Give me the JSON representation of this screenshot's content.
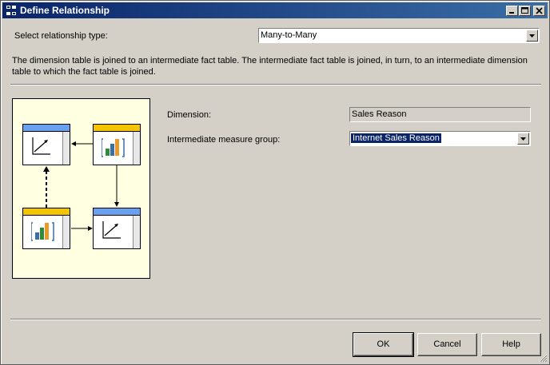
{
  "window": {
    "title": "Define Relationship"
  },
  "relationship_type": {
    "label": "Select relationship type:",
    "value": "Many-to-Many"
  },
  "description": "The dimension table is joined to an intermediate fact table. The intermediate fact table is joined, in turn, to an intermediate dimension table to which the fact table is joined.",
  "dimension": {
    "label": "Dimension:",
    "value": "Sales Reason"
  },
  "intermediate_measure_group": {
    "label": "Intermediate measure group:",
    "value": "Internet Sales Reason"
  },
  "buttons": {
    "ok": "OK",
    "cancel": "Cancel",
    "help": "Help"
  },
  "colors": {
    "dimension_header": "#6aa0f0",
    "fact_header": "#f5c400",
    "diagram_bg": "#ffffe1",
    "title_bar": "#0a246a"
  },
  "icons": {
    "dimension_table": "axis-chart-icon",
    "fact_table": "bar-chart-icon"
  }
}
